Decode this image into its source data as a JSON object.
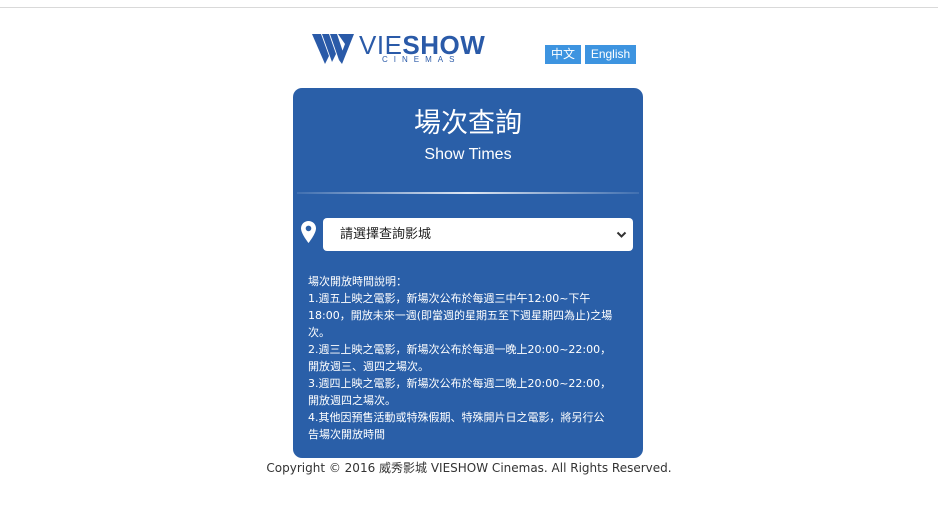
{
  "brand": {
    "name_light": "VIE",
    "name_bold": "SHOW",
    "tagline": "CINEMAS",
    "color": "#2a5aa8"
  },
  "language": {
    "chinese_label": "中文",
    "english_label": "English",
    "button_color": "#3d94e0"
  },
  "panel": {
    "title": "場次查詢",
    "subtitle": "Show Times",
    "background_color": "#2a5fa8",
    "cinema_select": {
      "value": "請選擇查詢影城",
      "icon": "map-pin-icon"
    },
    "notes": [
      "場次開放時間說明：",
      "1.週五上映之電影，新場次公布於每週三中午12:00~下午18:00，開放未來一週(即當週的星期五至下週星期四為止)之場次。",
      "2.週三上映之電影，新場次公布於每週一晚上20:00~22:00，開放週三、週四之場次。",
      "3.週四上映之電影，新場次公布於每週二晚上20:00~22:00，開放週四之場次。",
      "4.其他因預售活動或特殊假期、特殊開片日之電影，將另行公告場次開放時間"
    ]
  },
  "footer": {
    "copyright": "Copyright © 2016 威秀影城 VIESHOW Cinemas. All Rights Reserved."
  }
}
